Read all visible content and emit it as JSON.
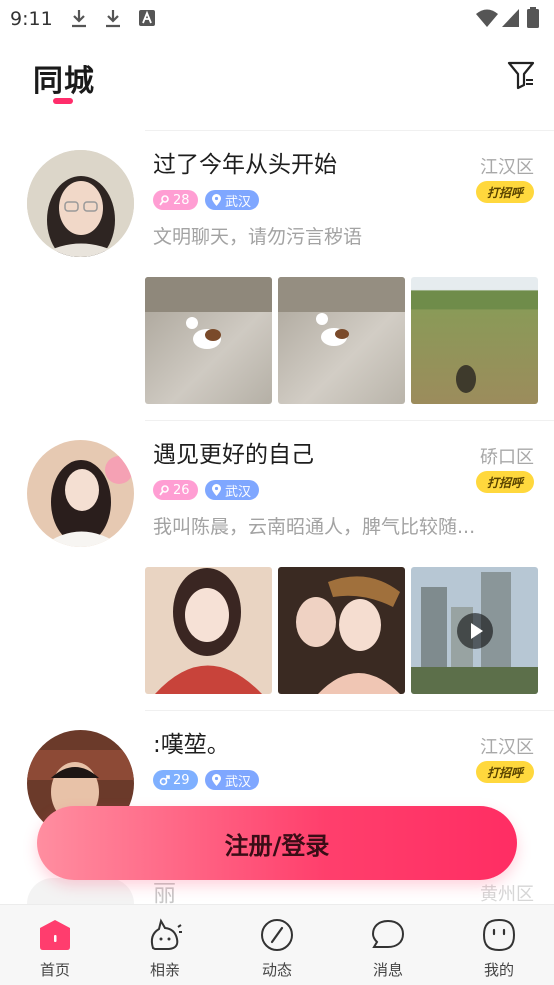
{
  "status_bar": {
    "time": "9:11"
  },
  "header": {
    "title": "同城"
  },
  "posts": [
    {
      "name": "过了今年从头开始",
      "age": "28",
      "city": "武汉",
      "bio": "文明聊天，请勿污言秽语",
      "district": "江汉区",
      "greet": "打招呼"
    },
    {
      "name": "遇见更好的自己",
      "age": "26",
      "city": "武汉",
      "bio": "我叫陈晨，云南昭通人，脾气比较随...",
      "district": "硚口区",
      "greet": "打招呼"
    },
    {
      "name": ":嘆堃。",
      "age": "29",
      "city": "武汉",
      "bio": "",
      "district": "江汉区",
      "greet": "打招呼"
    },
    {
      "name": "丽",
      "district": "黄州区"
    }
  ],
  "login_button": {
    "label": "注册/登录"
  },
  "tabbar": {
    "items": [
      {
        "label": "首页",
        "icon": "home-icon"
      },
      {
        "label": "相亲",
        "icon": "blind-date-icon"
      },
      {
        "label": "动态",
        "icon": "moments-icon"
      },
      {
        "label": "消息",
        "icon": "message-icon"
      },
      {
        "label": "我的",
        "icon": "profile-icon"
      }
    ]
  },
  "colors": {
    "accent": "#ff2d6b",
    "greet_bg": "#ffd83d",
    "female_badge": "#ff9ed3",
    "male_badge": "#7fb0ff",
    "city_badge": "#7fa7ff"
  }
}
